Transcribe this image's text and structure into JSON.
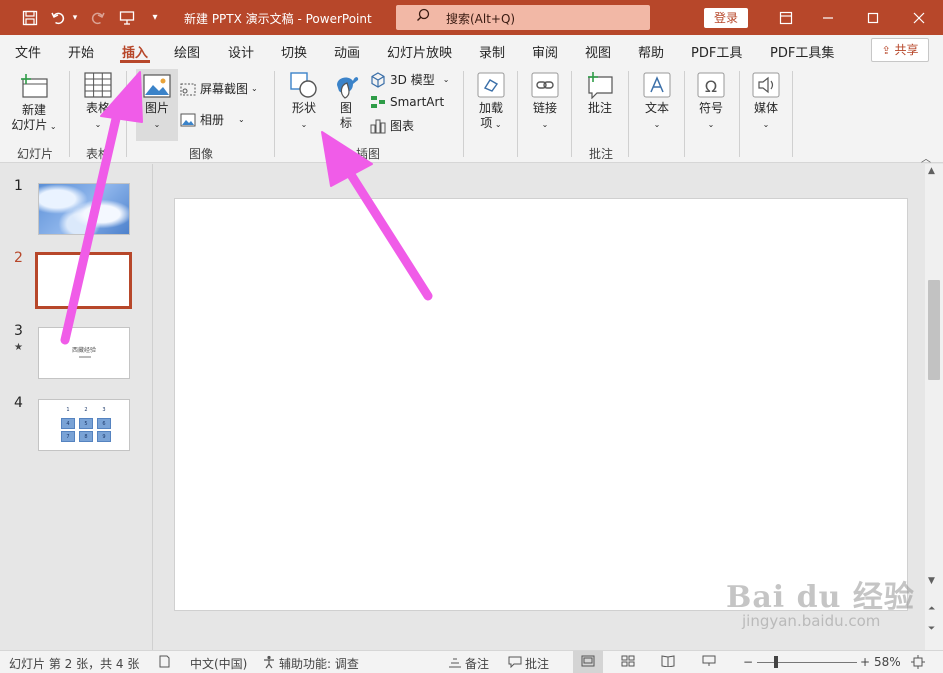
{
  "titlebar": {
    "doc_title": "新建 PPTX 演示文稿  -  PowerPoint",
    "search_placeholder": "搜索(Alt+Q)",
    "login": "登录"
  },
  "tabs": [
    "文件",
    "开始",
    "插入",
    "绘图",
    "设计",
    "切换",
    "动画",
    "幻灯片放映",
    "录制",
    "审阅",
    "视图",
    "帮助",
    "PDF工具",
    "PDF工具集"
  ],
  "active_tab": "插入",
  "share": "共享",
  "ribbon": {
    "new_slide_line1": "新建",
    "new_slide_line2": "幻灯片",
    "table": "表格",
    "picture": "图片",
    "screenshot": "屏幕截图",
    "album": "相册",
    "shapes": "形状",
    "icons_line1": "图",
    "icons_line2": "标",
    "model3d": "3D 模型",
    "smartart": "SmartArt",
    "chart": "图表",
    "addins_line1": "加载",
    "addins_line2": "项",
    "link": "链接",
    "comment": "批注",
    "text": "文本",
    "symbol": "符号",
    "media": "媒体",
    "groups": {
      "slides": "幻灯片",
      "tables": "表格",
      "images": "图像",
      "illustrations": "插图",
      "comments": "批注"
    }
  },
  "slides": [
    {
      "number": "1"
    },
    {
      "number": "2"
    },
    {
      "number": "3",
      "title": "西藏经验"
    },
    {
      "number": "4",
      "cells": [
        "1",
        "2",
        "3",
        "4",
        "5",
        "6",
        "7",
        "8",
        "9"
      ]
    }
  ],
  "statusbar": {
    "slide_info": "幻灯片 第 2 张，共 4 张",
    "language": "中文(中国)",
    "accessibility": "辅助功能: 调查",
    "notes": "备注",
    "comments": "批注",
    "zoom": "58%"
  },
  "watermark": {
    "main": "Bai du 经验",
    "sub": "jingyan.baidu.com"
  },
  "colors": {
    "accent": "#b7472a",
    "annotation_arrow": "#f05ce8"
  }
}
